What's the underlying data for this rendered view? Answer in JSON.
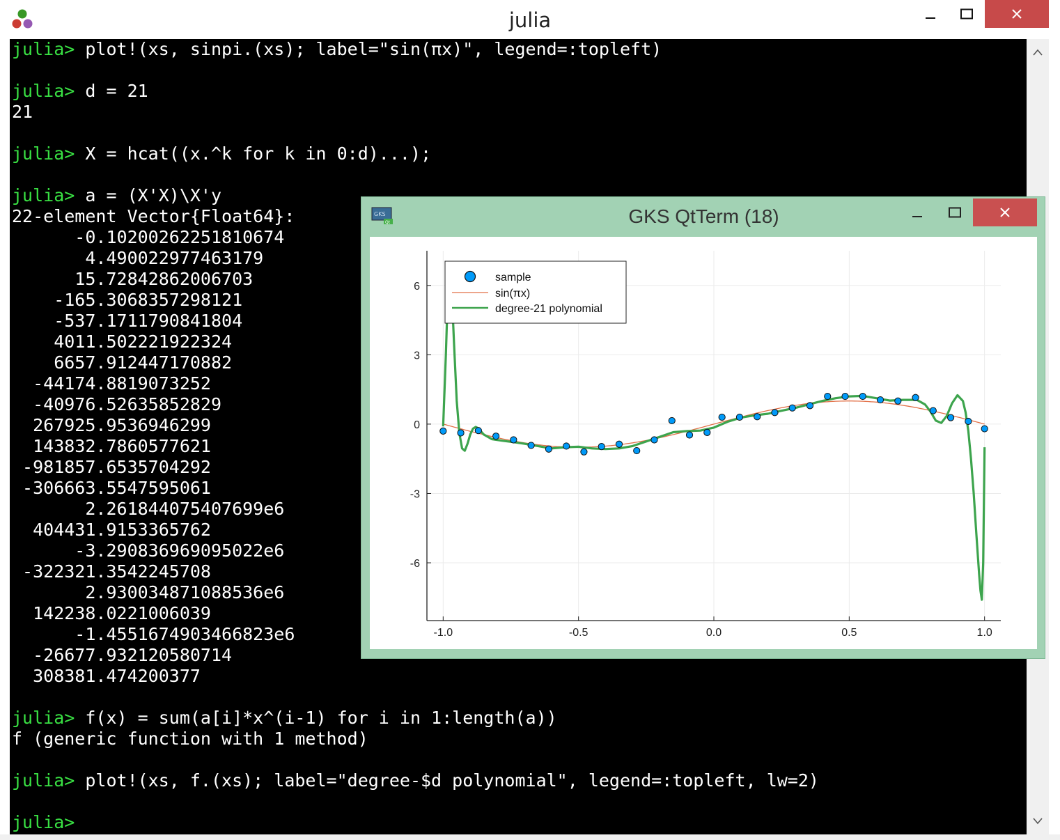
{
  "window": {
    "title": "julia",
    "icon": "julia-logo-icon"
  },
  "colors": {
    "prompt": "#39e043",
    "terminal_bg": "#000000",
    "terminal_fg": "#ffffff",
    "close": "#c74a4a",
    "gks_frame": "#a2d2b4",
    "sample": "#009af9",
    "sin": "#e26f46",
    "poly": "#3da44d"
  },
  "terminal": {
    "lines": [
      {
        "prompt": "julia> ",
        "text": "plot!(xs, sinpi.(xs); label=\"sin(πx)\", legend=:topleft)"
      },
      {
        "prompt": "",
        "text": ""
      },
      {
        "prompt": "julia> ",
        "text": "d = 21"
      },
      {
        "prompt": "",
        "text": "21"
      },
      {
        "prompt": "",
        "text": ""
      },
      {
        "prompt": "julia> ",
        "text": "X = hcat((x.^k for k in 0:d)...);"
      },
      {
        "prompt": "",
        "text": ""
      },
      {
        "prompt": "julia> ",
        "text": "a = (X'X)\\X'y"
      },
      {
        "prompt": "",
        "text": "22-element Vector{Float64}:"
      },
      {
        "prompt": "",
        "text": "      -0.10200262251810674"
      },
      {
        "prompt": "",
        "text": "       4.490022977463179"
      },
      {
        "prompt": "",
        "text": "      15.72842862006703"
      },
      {
        "prompt": "",
        "text": "    -165.3068357298121"
      },
      {
        "prompt": "",
        "text": "    -537.1711790841804"
      },
      {
        "prompt": "",
        "text": "    4011.502221922324"
      },
      {
        "prompt": "",
        "text": "    6657.912447170882"
      },
      {
        "prompt": "",
        "text": "  -44174.8819073252"
      },
      {
        "prompt": "",
        "text": "  -40976.52635852829"
      },
      {
        "prompt": "",
        "text": "  267925.9536946299"
      },
      {
        "prompt": "",
        "text": "  143832.7860577621"
      },
      {
        "prompt": "",
        "text": " -981857.6535704292"
      },
      {
        "prompt": "",
        "text": " -306663.5547595061"
      },
      {
        "prompt": "",
        "text": "       2.261844075407699e6"
      },
      {
        "prompt": "",
        "text": "  404431.9153365762"
      },
      {
        "prompt": "",
        "text": "      -3.290836969095022e6"
      },
      {
        "prompt": "",
        "text": " -322321.3542245708"
      },
      {
        "prompt": "",
        "text": "       2.930034871088536e6"
      },
      {
        "prompt": "",
        "text": "  142238.0221006039"
      },
      {
        "prompt": "",
        "text": "      -1.4551674903466823e6"
      },
      {
        "prompt": "",
        "text": "  -26677.932120580714"
      },
      {
        "prompt": "",
        "text": "  308381.474200377"
      },
      {
        "prompt": "",
        "text": ""
      },
      {
        "prompt": "julia> ",
        "text": "f(x) = sum(a[i]*x^(i-1) for i in 1:length(a))"
      },
      {
        "prompt": "",
        "text": "f (generic function with 1 method)"
      },
      {
        "prompt": "",
        "text": ""
      },
      {
        "prompt": "julia> ",
        "text": "plot!(xs, f.(xs); label=\"degree-$d polynomial\", legend=:topleft, lw=2)"
      },
      {
        "prompt": "",
        "text": ""
      },
      {
        "prompt": "julia> ",
        "text": ""
      }
    ]
  },
  "gks_window": {
    "title": "GKS QtTerm (18)",
    "icon": "gks-app-icon"
  },
  "chart_data": {
    "type": "scatter",
    "xlim": [
      -1.06,
      1.06
    ],
    "ylim": [
      -8.5,
      7.5
    ],
    "xticks": [
      -1.0,
      -0.5,
      0.0,
      0.5,
      1.0
    ],
    "xtick_labels": [
      "-1.0",
      "-0.5",
      "0.0",
      "0.5",
      "1.0"
    ],
    "yticks": [
      6,
      3,
      0,
      -3,
      -6
    ],
    "ytick_labels": [
      "6",
      "3",
      "0",
      "-3",
      "-6"
    ],
    "grid": true,
    "legend_position": "top-left",
    "series": [
      {
        "name": "sample",
        "kind": "scatter",
        "x": [
          -1.0,
          -0.935,
          -0.87,
          -0.805,
          -0.74,
          -0.675,
          -0.61,
          -0.545,
          -0.48,
          -0.415,
          -0.35,
          -0.285,
          -0.22,
          -0.155,
          -0.09,
          -0.025,
          0.03,
          0.095,
          0.16,
          0.225,
          0.29,
          0.355,
          0.42,
          0.485,
          0.55,
          0.615,
          0.68,
          0.745,
          0.81,
          0.875,
          0.94,
          1.0
        ],
        "y": [
          -0.3,
          -0.38,
          -0.28,
          -0.52,
          -0.68,
          -0.92,
          -1.08,
          -0.95,
          -1.2,
          -0.97,
          -0.87,
          -1.15,
          -0.68,
          0.15,
          -0.47,
          -0.36,
          0.3,
          0.3,
          0.32,
          0.5,
          0.7,
          0.8,
          1.2,
          1.2,
          1.2,
          1.05,
          1.0,
          1.15,
          0.58,
          0.28,
          0.12,
          -0.2
        ]
      },
      {
        "name": "sin(πx)",
        "kind": "line",
        "function": "sin(pi*x)"
      },
      {
        "name": "degree-21 polynomial",
        "kind": "line",
        "x": [
          -1.0,
          -0.99,
          -0.98,
          -0.97,
          -0.96,
          -0.95,
          -0.94,
          -0.93,
          -0.92,
          -0.91,
          -0.9,
          -0.89,
          -0.88,
          -0.87,
          -0.86,
          -0.85,
          -0.82,
          -0.78,
          -0.74,
          -0.7,
          -0.65,
          -0.6,
          -0.55,
          -0.5,
          -0.45,
          -0.4,
          -0.35,
          -0.3,
          -0.25,
          -0.2,
          -0.15,
          -0.1,
          -0.05,
          0.0,
          0.05,
          0.1,
          0.15,
          0.2,
          0.25,
          0.3,
          0.35,
          0.4,
          0.45,
          0.5,
          0.55,
          0.6,
          0.65,
          0.7,
          0.75,
          0.78,
          0.8,
          0.82,
          0.84,
          0.86,
          0.88,
          0.9,
          0.92,
          0.93,
          0.94,
          0.95,
          0.96,
          0.97,
          0.98,
          0.985,
          0.99,
          0.995,
          1.0
        ],
        "y": [
          -0.1,
          3.0,
          6.7,
          6.2,
          3.5,
          1.0,
          -0.4,
          -1.05,
          -1.15,
          -0.85,
          -0.45,
          -0.2,
          -0.12,
          -0.18,
          -0.32,
          -0.45,
          -0.65,
          -0.72,
          -0.78,
          -0.85,
          -0.95,
          -1.05,
          -1.0,
          -0.98,
          -1.05,
          -1.08,
          -1.05,
          -0.95,
          -0.75,
          -0.55,
          -0.35,
          -0.3,
          -0.28,
          -0.15,
          0.1,
          0.28,
          0.38,
          0.45,
          0.58,
          0.7,
          0.85,
          1.0,
          1.12,
          1.2,
          1.22,
          1.12,
          1.02,
          1.05,
          1.05,
          0.85,
          0.55,
          0.15,
          0.05,
          0.35,
          0.9,
          1.25,
          1.0,
          0.5,
          -0.3,
          -1.5,
          -3.0,
          -4.8,
          -6.5,
          -7.2,
          -7.6,
          -6.0,
          -1.0
        ]
      }
    ]
  }
}
